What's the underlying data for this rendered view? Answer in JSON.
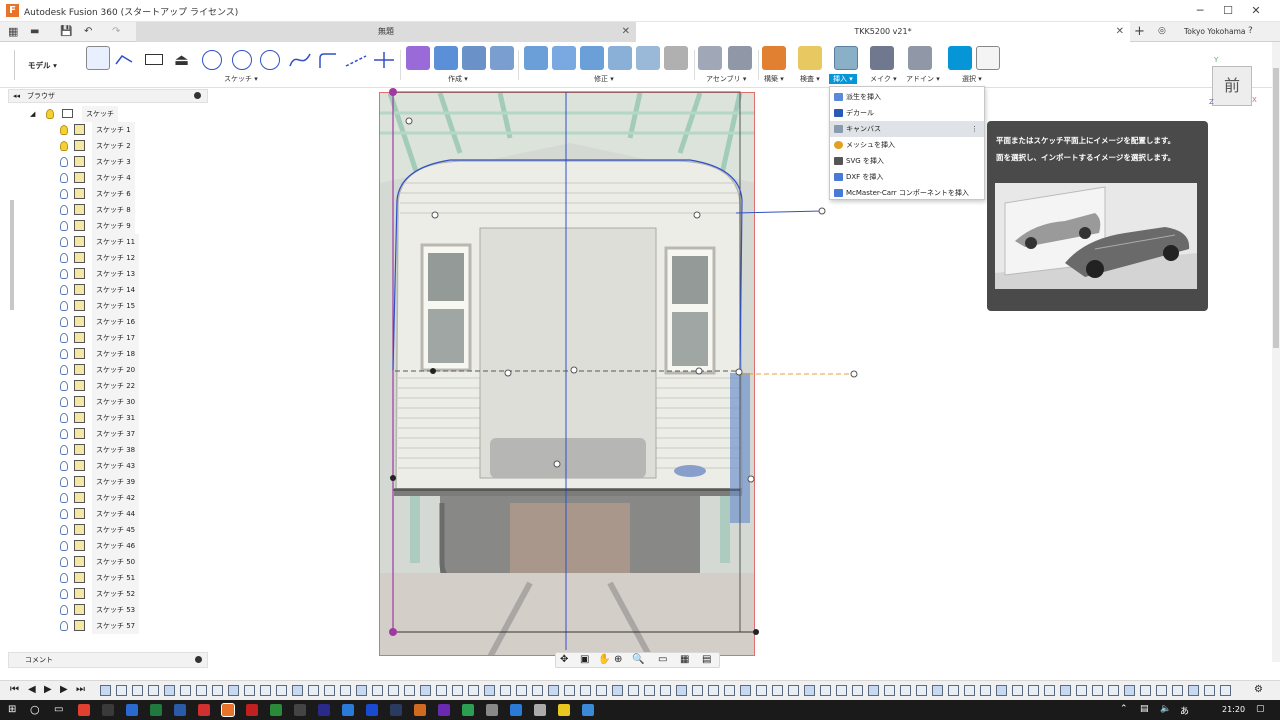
{
  "window": {
    "app_title": "Autodesk Fusion 360 (スタートアップ ライセンス)",
    "logo": "F"
  },
  "tabs": [
    {
      "label": "無題"
    },
    {
      "label": "TKK5200 v21*"
    }
  ],
  "user": {
    "name": "Tokyo Yokohama"
  },
  "toolbar": {
    "workspace": "モデル",
    "groups": [
      "スケッチ",
      "作成",
      "修正",
      "アセンブリ",
      "構築",
      "検査",
      "挿入",
      "メイク",
      "アドイン",
      "選択"
    ]
  },
  "browser": {
    "header": "ブラウザ",
    "root": "スケッチ",
    "items": [
      {
        "label": "スケッチ 1",
        "visible": true
      },
      {
        "label": "スケッチ 2",
        "visible": true
      },
      {
        "label": "スケッチ 3",
        "visible": false
      },
      {
        "label": "スケッチ 4",
        "visible": false
      },
      {
        "label": "スケッチ 6",
        "visible": false
      },
      {
        "label": "スケッチ 8",
        "visible": false
      },
      {
        "label": "スケッチ 9",
        "visible": false
      },
      {
        "label": "スケッチ 11",
        "visible": false
      },
      {
        "label": "スケッチ 12",
        "visible": false
      },
      {
        "label": "スケッチ 13",
        "visible": false
      },
      {
        "label": "スケッチ 14",
        "visible": false
      },
      {
        "label": "スケッチ 15",
        "visible": false
      },
      {
        "label": "スケッチ 16",
        "visible": false
      },
      {
        "label": "スケッチ 17",
        "visible": false
      },
      {
        "label": "スケッチ 18",
        "visible": false
      },
      {
        "label": "スケッチ 20",
        "visible": false
      },
      {
        "label": "スケッチ 22",
        "visible": false
      },
      {
        "label": "スケッチ 30",
        "visible": false
      },
      {
        "label": "スケッチ 31",
        "visible": false
      },
      {
        "label": "スケッチ 37",
        "visible": false
      },
      {
        "label": "スケッチ 38",
        "visible": false
      },
      {
        "label": "スケッチ 43",
        "visible": false
      },
      {
        "label": "スケッチ 39",
        "visible": false
      },
      {
        "label": "スケッチ 42",
        "visible": false
      },
      {
        "label": "スケッチ 44",
        "visible": false
      },
      {
        "label": "スケッチ 45",
        "visible": false
      },
      {
        "label": "スケッチ 46",
        "visible": false
      },
      {
        "label": "スケッチ 50",
        "visible": false
      },
      {
        "label": "スケッチ 51",
        "visible": false
      },
      {
        "label": "スケッチ 52",
        "visible": false
      },
      {
        "label": "スケッチ 53",
        "visible": false
      },
      {
        "label": "スケッチ 57",
        "visible": false
      }
    ]
  },
  "insert_menu": {
    "items": [
      {
        "label": "派生を挿入",
        "icon": "derive-icon"
      },
      {
        "label": "デカール",
        "icon": "decal-icon"
      },
      {
        "label": "キャンバス",
        "icon": "canvas-icon",
        "highlighted": true
      },
      {
        "label": "メッシュを挿入",
        "icon": "mesh-icon"
      },
      {
        "label": "SVG を挿入",
        "icon": "svg-icon"
      },
      {
        "label": "DXF を挿入",
        "icon": "dxf-icon"
      },
      {
        "label": "McMaster-Carr コンポーネントを挿入",
        "icon": "mcmaster-icon"
      }
    ]
  },
  "tooltip": {
    "line1": "平面またはスケッチ平面上にイメージを配置します。",
    "line2": "面を選択し、インポートするイメージを選択します。"
  },
  "viewcube": {
    "face": "前"
  },
  "comment_panel": {
    "label": "コメント"
  },
  "taskbar": {
    "time": "21:20"
  },
  "colors": {
    "accent": "#0696d7",
    "sketch_line": "#3050c8",
    "canvas_border": "#e07070"
  }
}
